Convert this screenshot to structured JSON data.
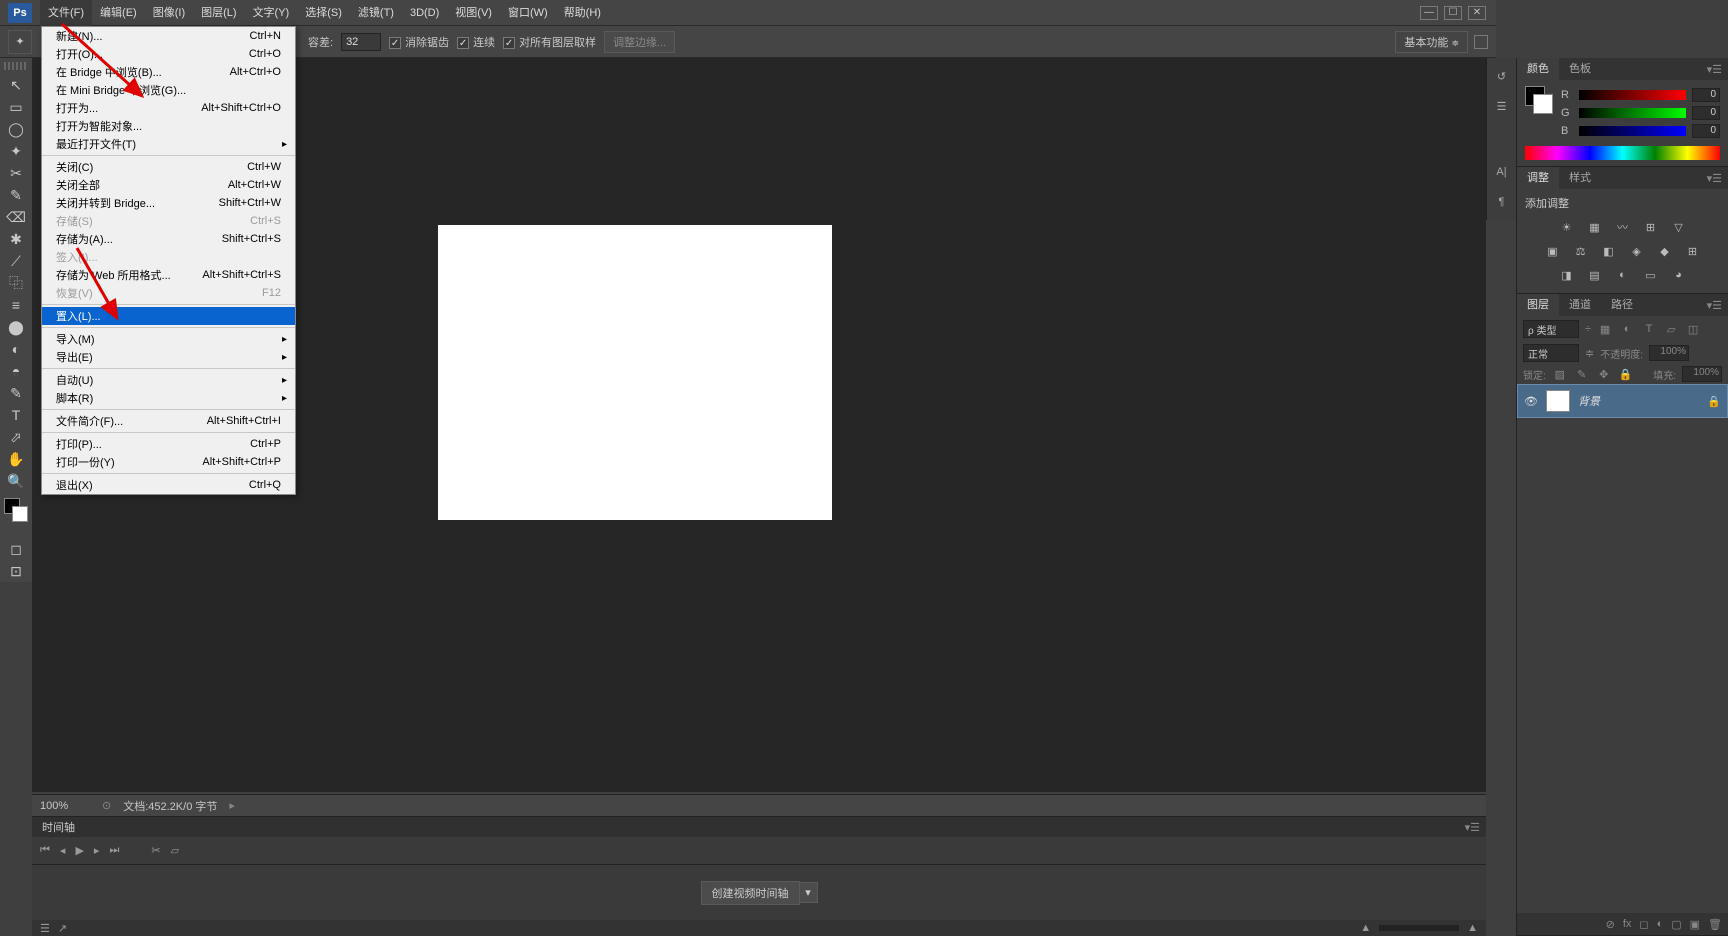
{
  "menubar": {
    "items": [
      "文件(F)",
      "编辑(E)",
      "图像(I)",
      "图层(L)",
      "文字(Y)",
      "选择(S)",
      "滤镜(T)",
      "3D(D)",
      "视图(V)",
      "窗口(W)",
      "帮助(H)"
    ]
  },
  "dropdown": {
    "groups": [
      [
        {
          "label": "新建(N)...",
          "short": "Ctrl+N"
        },
        {
          "label": "打开(O)...",
          "short": "Ctrl+O"
        },
        {
          "label": "在 Bridge 中浏览(B)...",
          "short": "Alt+Ctrl+O"
        },
        {
          "label": "在 Mini Bridge 中浏览(G)..."
        },
        {
          "label": "打开为...",
          "short": "Alt+Shift+Ctrl+O"
        },
        {
          "label": "打开为智能对象..."
        },
        {
          "label": "最近打开文件(T)",
          "sub": true
        }
      ],
      [
        {
          "label": "关闭(C)",
          "short": "Ctrl+W"
        },
        {
          "label": "关闭全部",
          "short": "Alt+Ctrl+W"
        },
        {
          "label": "关闭并转到 Bridge...",
          "short": "Shift+Ctrl+W"
        },
        {
          "label": "存储(S)",
          "short": "Ctrl+S",
          "disabled": true
        },
        {
          "label": "存储为(A)...",
          "short": "Shift+Ctrl+S"
        },
        {
          "label": "签入(I)...",
          "disabled": true
        },
        {
          "label": "存储为 Web 所用格式...",
          "short": "Alt+Shift+Ctrl+S"
        },
        {
          "label": "恢复(V)",
          "short": "F12",
          "disabled": true
        }
      ],
      [
        {
          "label": "置入(L)...",
          "highlight": true
        }
      ],
      [
        {
          "label": "导入(M)",
          "sub": true
        },
        {
          "label": "导出(E)",
          "sub": true
        }
      ],
      [
        {
          "label": "自动(U)",
          "sub": true
        },
        {
          "label": "脚本(R)",
          "sub": true
        }
      ],
      [
        {
          "label": "文件简介(F)...",
          "short": "Alt+Shift+Ctrl+I"
        }
      ],
      [
        {
          "label": "打印(P)...",
          "short": "Ctrl+P"
        },
        {
          "label": "打印一份(Y)",
          "short": "Alt+Shift+Ctrl+P"
        }
      ],
      [
        {
          "label": "退出(X)",
          "short": "Ctrl+Q"
        }
      ]
    ]
  },
  "optbar": {
    "tolerance_label": "容差:",
    "tolerance": "32",
    "antialias": "消除锯齿",
    "contiguous": "连续",
    "all_layers": "对所有图层取样",
    "refine": "调整边缘...",
    "essential": "基本功能"
  },
  "tools": [
    "↖",
    "▭",
    "◯",
    "✦",
    "✂",
    "✎",
    "⌫",
    "✱",
    "⟋",
    "⿻",
    "≡",
    "⬤",
    "◐",
    "◓",
    "✎",
    "T",
    "⬀",
    "✋",
    "🔍"
  ],
  "status": {
    "zoom": "100%",
    "docinfo": "文档:452.2K/0 字节"
  },
  "panels": {
    "color": {
      "tab1": "颜色",
      "tab2": "色板",
      "r": "R",
      "g": "G",
      "b": "B",
      "val": "0"
    },
    "adjust": {
      "tab1": "调整",
      "tab2": "样式",
      "title": "添加调整"
    },
    "layers": {
      "tab1": "图层",
      "tab2": "通道",
      "tab3": "路径",
      "kind": "ρ 类型",
      "mode": "正常",
      "opacity_lbl": "不透明度:",
      "opacity": "100%",
      "lock_lbl": "锁定:",
      "fill_lbl": "填充:",
      "fill": "100%",
      "item": {
        "name": "背景"
      }
    }
  },
  "timeline": {
    "tab": "时间轴",
    "create": "创建视频时间轴"
  }
}
